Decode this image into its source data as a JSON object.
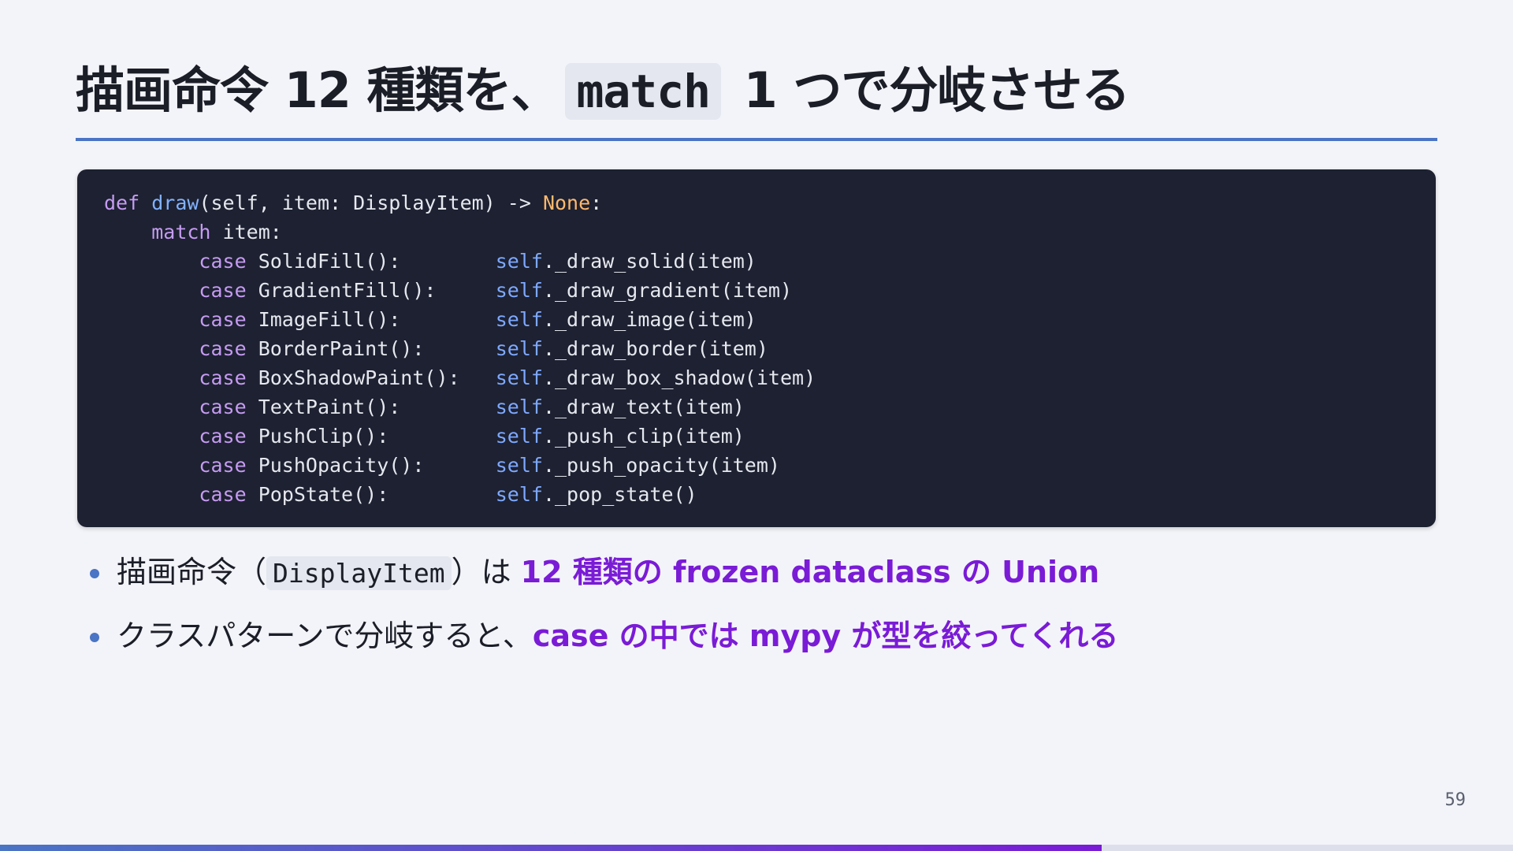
{
  "slide": {
    "title_before": "描画命令 12 種類を、",
    "title_code": "match",
    "title_after": "1 つで分岐させる",
    "page_number": "59",
    "progress": 0.728
  },
  "code": {
    "language": "python",
    "lines": [
      {
        "tokens": [
          {
            "t": "def",
            "c": "kw"
          },
          {
            "t": " ",
            "c": ""
          },
          {
            "t": "draw",
            "c": "fn"
          },
          {
            "t": "(self, item: DisplayItem) -> ",
            "c": ""
          },
          {
            "t": "None",
            "c": "nn"
          },
          {
            "t": ":",
            "c": ""
          }
        ]
      },
      {
        "tokens": [
          {
            "t": "    ",
            "c": ""
          },
          {
            "t": "match",
            "c": "kw"
          },
          {
            "t": " item:",
            "c": ""
          }
        ]
      },
      {
        "tokens": [
          {
            "t": "        ",
            "c": ""
          },
          {
            "t": "case",
            "c": "kw"
          },
          {
            "t": " SolidFill():        ",
            "c": ""
          },
          {
            "t": "self",
            "c": "sf"
          },
          {
            "t": "._draw_solid(item)",
            "c": ""
          }
        ]
      },
      {
        "tokens": [
          {
            "t": "        ",
            "c": ""
          },
          {
            "t": "case",
            "c": "kw"
          },
          {
            "t": " GradientFill():     ",
            "c": ""
          },
          {
            "t": "self",
            "c": "sf"
          },
          {
            "t": "._draw_gradient(item)",
            "c": ""
          }
        ]
      },
      {
        "tokens": [
          {
            "t": "        ",
            "c": ""
          },
          {
            "t": "case",
            "c": "kw"
          },
          {
            "t": " ImageFill():        ",
            "c": ""
          },
          {
            "t": "self",
            "c": "sf"
          },
          {
            "t": "._draw_image(item)",
            "c": ""
          }
        ]
      },
      {
        "tokens": [
          {
            "t": "        ",
            "c": ""
          },
          {
            "t": "case",
            "c": "kw"
          },
          {
            "t": " BorderPaint():      ",
            "c": ""
          },
          {
            "t": "self",
            "c": "sf"
          },
          {
            "t": "._draw_border(item)",
            "c": ""
          }
        ]
      },
      {
        "tokens": [
          {
            "t": "        ",
            "c": ""
          },
          {
            "t": "case",
            "c": "kw"
          },
          {
            "t": " BoxShadowPaint():   ",
            "c": ""
          },
          {
            "t": "self",
            "c": "sf"
          },
          {
            "t": "._draw_box_shadow(item)",
            "c": ""
          }
        ]
      },
      {
        "tokens": [
          {
            "t": "        ",
            "c": ""
          },
          {
            "t": "case",
            "c": "kw"
          },
          {
            "t": " TextPaint():        ",
            "c": ""
          },
          {
            "t": "self",
            "c": "sf"
          },
          {
            "t": "._draw_text(item)",
            "c": ""
          }
        ]
      },
      {
        "tokens": [
          {
            "t": "        ",
            "c": ""
          },
          {
            "t": "case",
            "c": "kw"
          },
          {
            "t": " PushClip():         ",
            "c": ""
          },
          {
            "t": "self",
            "c": "sf"
          },
          {
            "t": "._push_clip(item)",
            "c": ""
          }
        ]
      },
      {
        "tokens": [
          {
            "t": "        ",
            "c": ""
          },
          {
            "t": "case",
            "c": "kw"
          },
          {
            "t": " PushOpacity():      ",
            "c": ""
          },
          {
            "t": "self",
            "c": "sf"
          },
          {
            "t": "._push_opacity(item)",
            "c": ""
          }
        ]
      },
      {
        "tokens": [
          {
            "t": "        ",
            "c": ""
          },
          {
            "t": "case",
            "c": "kw"
          },
          {
            "t": " PopState():         ",
            "c": ""
          },
          {
            "t": "self",
            "c": "sf"
          },
          {
            "t": "._pop_state()",
            "c": ""
          }
        ]
      }
    ]
  },
  "bullets": [
    {
      "prefix": "描画命令（",
      "code": "DisplayItem",
      "middle": "）は ",
      "emphasis": "12 種類の frozen dataclass の Union"
    },
    {
      "prefix": "クラスパターンで分岐すると、",
      "emphasis": "case の中では mypy が型を絞ってくれる"
    }
  ],
  "colors": {
    "background": "#f3f4f9",
    "accent_blue": "#4a74c4",
    "emphasis_purple": "#7a1bd6",
    "code_background": "#1d2131",
    "keyword": "#c69bf2",
    "function": "#82b1ff",
    "none_constant": "#ffb86c",
    "self": "#7ea8ff"
  }
}
